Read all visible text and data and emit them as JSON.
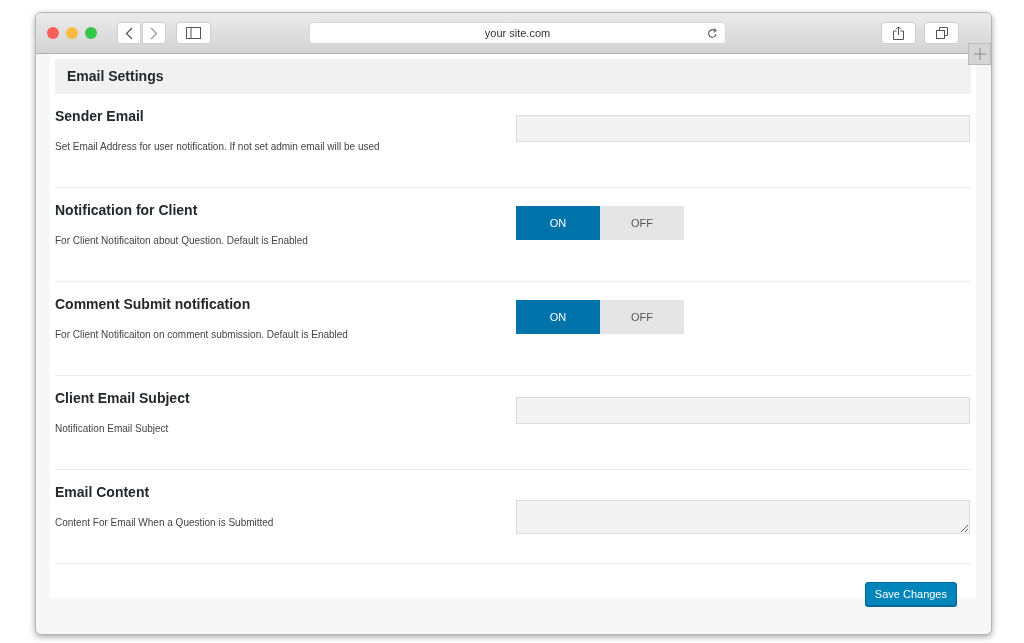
{
  "browser": {
    "address": "your site.com"
  },
  "section_title": "Email Settings",
  "settings": [
    {
      "kind": "text",
      "title": "Sender Email",
      "description": "Set Email Address for user notification. If not set admin email will be used"
    },
    {
      "kind": "toggle",
      "title": "Notification for Client",
      "description": "For Client Notificaiton about Question. Default is Enabled",
      "on_label": "ON",
      "off_label": "OFF",
      "on": true
    },
    {
      "kind": "toggle",
      "title": "Comment Submit notification",
      "description": "For Client Notificaiton on comment submission. Default is Enabled",
      "on_label": "ON",
      "off_label": "OFF",
      "on": true
    },
    {
      "kind": "text",
      "title": "Client Email Subject",
      "description": "Notification Email Subject"
    },
    {
      "kind": "textarea",
      "title": "Email Content",
      "description": "Content For Email When a Question is Submitted"
    }
  ],
  "save_button": "Save Changes"
}
